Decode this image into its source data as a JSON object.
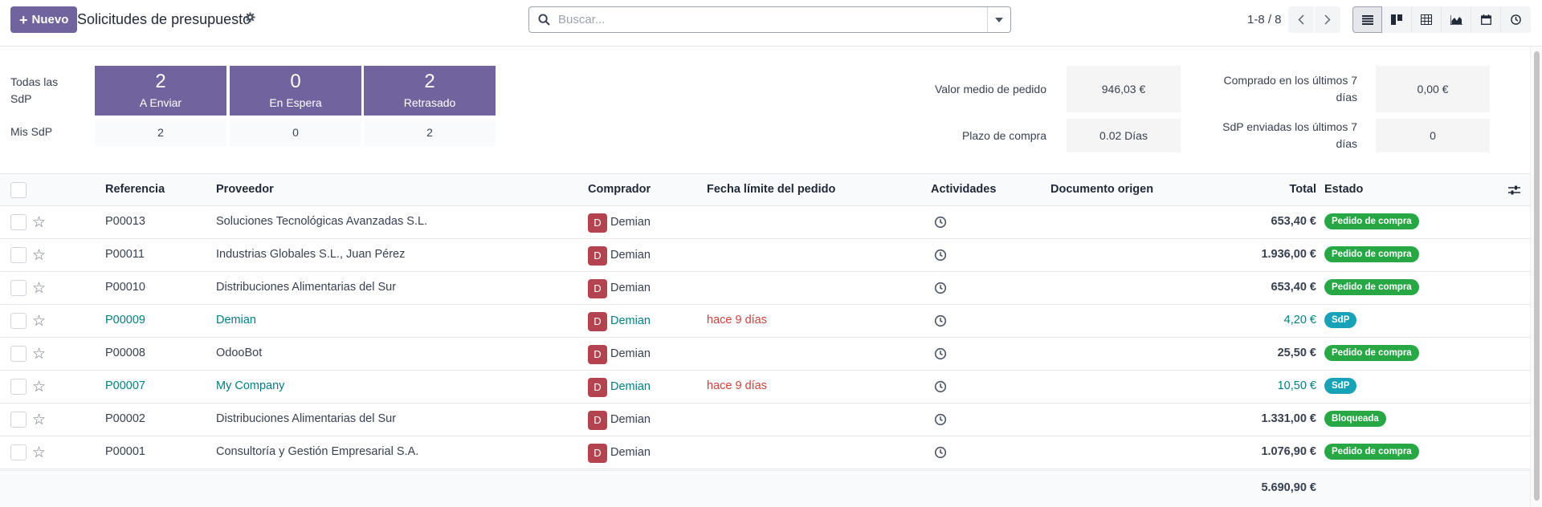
{
  "header": {
    "new_button": "Nuevo",
    "title": "Solicitudes de presupuesto",
    "search_placeholder": "Buscar...",
    "pager": "1-8 / 8"
  },
  "views": [
    "list-view-icon",
    "kanban-view-icon",
    "pivot-view-icon",
    "graph-view-icon",
    "calendar-view-icon",
    "activity-view-icon"
  ],
  "dashboard": {
    "row_all": "Todas las SdP",
    "row_mine": "Mis SdP",
    "tiles": [
      {
        "count": "2",
        "label": "A Enviar",
        "mine": "2"
      },
      {
        "count": "0",
        "label": "En Espera",
        "mine": "0"
      },
      {
        "count": "2",
        "label": "Retrasado",
        "mine": "2"
      }
    ],
    "metrics": {
      "avg_label": "Valor medio de pedido",
      "avg_value": "946,03 €",
      "lead_label": "Plazo de compra",
      "lead_value": "0.02 Días",
      "bought_label": "Comprado en los últimos 7 días",
      "bought_value": "0,00 €",
      "sent_label": "SdP enviadas los últimos 7 días",
      "sent_value": "0"
    }
  },
  "table": {
    "columns": {
      "ref": "Referencia",
      "vendor": "Proveedor",
      "buyer": "Comprador",
      "deadline": "Fecha límite del pedido",
      "activities": "Actividades",
      "source": "Documento origen",
      "total": "Total",
      "state": "Estado"
    },
    "rows": [
      {
        "ref": "P00013",
        "vendor": "Soluciones Tecnológicas Avanzadas S.L.",
        "buyer": "Demian",
        "initial": "D",
        "deadline": "",
        "total": "653,40 €",
        "state": "Pedido de compra",
        "state_color": "#28a745",
        "highlight": false
      },
      {
        "ref": "P00011",
        "vendor": "Industrias Globales S.L., Juan Pérez",
        "buyer": "Demian",
        "initial": "D",
        "deadline": "",
        "total": "1.936,00 €",
        "state": "Pedido de compra",
        "state_color": "#28a745",
        "highlight": false
      },
      {
        "ref": "P00010",
        "vendor": "Distribuciones Alimentarias del Sur",
        "buyer": "Demian",
        "initial": "D",
        "deadline": "",
        "total": "653,40 €",
        "state": "Pedido de compra",
        "state_color": "#28a745",
        "highlight": false
      },
      {
        "ref": "P00009",
        "vendor": "Demian",
        "buyer": "Demian",
        "initial": "D",
        "deadline": "hace 9 días",
        "total": "4,20 €",
        "state": "SdP",
        "state_color": "#17a2b8",
        "highlight": true
      },
      {
        "ref": "P00008",
        "vendor": "OdooBot",
        "buyer": "Demian",
        "initial": "D",
        "deadline": "",
        "total": "25,50 €",
        "state": "Pedido de compra",
        "state_color": "#28a745",
        "highlight": false
      },
      {
        "ref": "P00007",
        "vendor": "My Company",
        "buyer": "Demian",
        "initial": "D",
        "deadline": "hace 9 días",
        "total": "10,50 €",
        "state": "SdP",
        "state_color": "#17a2b8",
        "highlight": true
      },
      {
        "ref": "P00002",
        "vendor": "Distribuciones Alimentarias del Sur",
        "buyer": "Demian",
        "initial": "D",
        "deadline": "",
        "total": "1.331,00 €",
        "state": "Bloqueada",
        "state_color": "#28a745",
        "highlight": false
      },
      {
        "ref": "P00001",
        "vendor": "Consultoría y Gestión Empresarial S.A.",
        "buyer": "Demian",
        "initial": "D",
        "deadline": "",
        "total": "1.076,90 €",
        "state": "Pedido de compra",
        "state_color": "#28a745",
        "highlight": false
      }
    ],
    "grand_total": "5.690,90 €"
  }
}
